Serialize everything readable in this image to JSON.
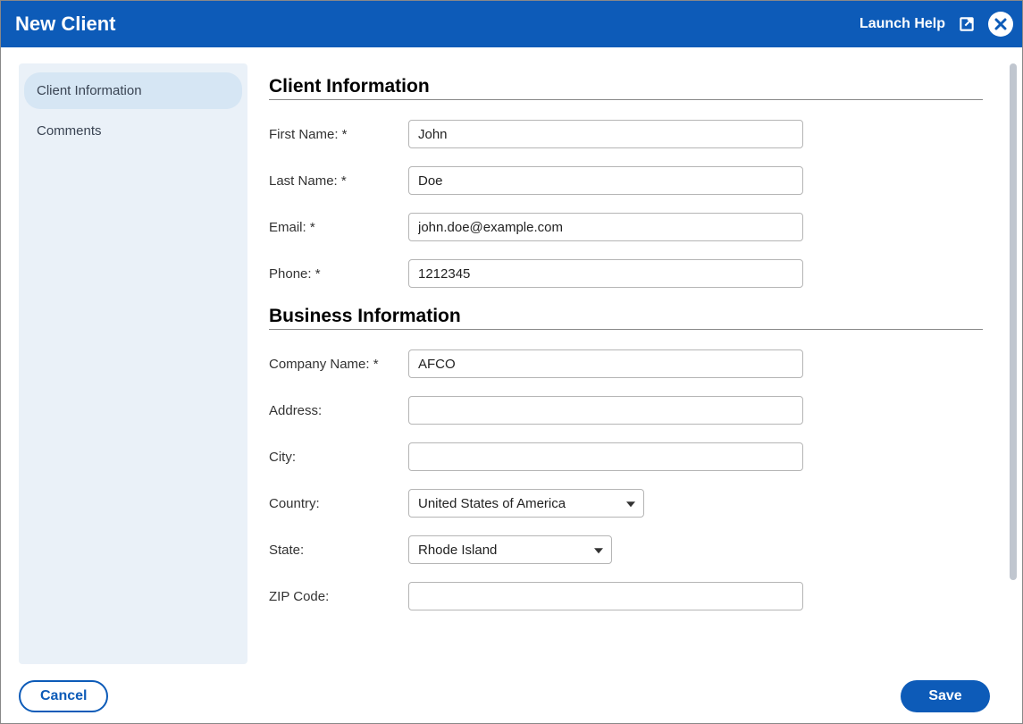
{
  "header": {
    "title": "New Client",
    "launch_help": "Launch Help"
  },
  "sidebar": {
    "items": [
      {
        "label": "Client Information",
        "active": true
      },
      {
        "label": "Comments",
        "active": false
      }
    ]
  },
  "sections": {
    "client_info": {
      "title": "Client Information",
      "fields": {
        "first_name": {
          "label": "First Name: *",
          "value": "John"
        },
        "last_name": {
          "label": "Last Name: *",
          "value": "Doe"
        },
        "email": {
          "label": "Email: *",
          "value": "john.doe@example.com"
        },
        "phone": {
          "label": "Phone: *",
          "value": "1212345"
        }
      }
    },
    "business_info": {
      "title": "Business Information",
      "fields": {
        "company_name": {
          "label": "Company Name: *",
          "value": "AFCO"
        },
        "address": {
          "label": "Address:",
          "value": ""
        },
        "city": {
          "label": "City:",
          "value": ""
        },
        "country": {
          "label": "Country:",
          "value": "United States of America"
        },
        "state": {
          "label": "State:",
          "value": "Rhode Island"
        },
        "zip": {
          "label": "ZIP Code:",
          "value": ""
        }
      }
    }
  },
  "footer": {
    "cancel": "Cancel",
    "save": "Save"
  }
}
